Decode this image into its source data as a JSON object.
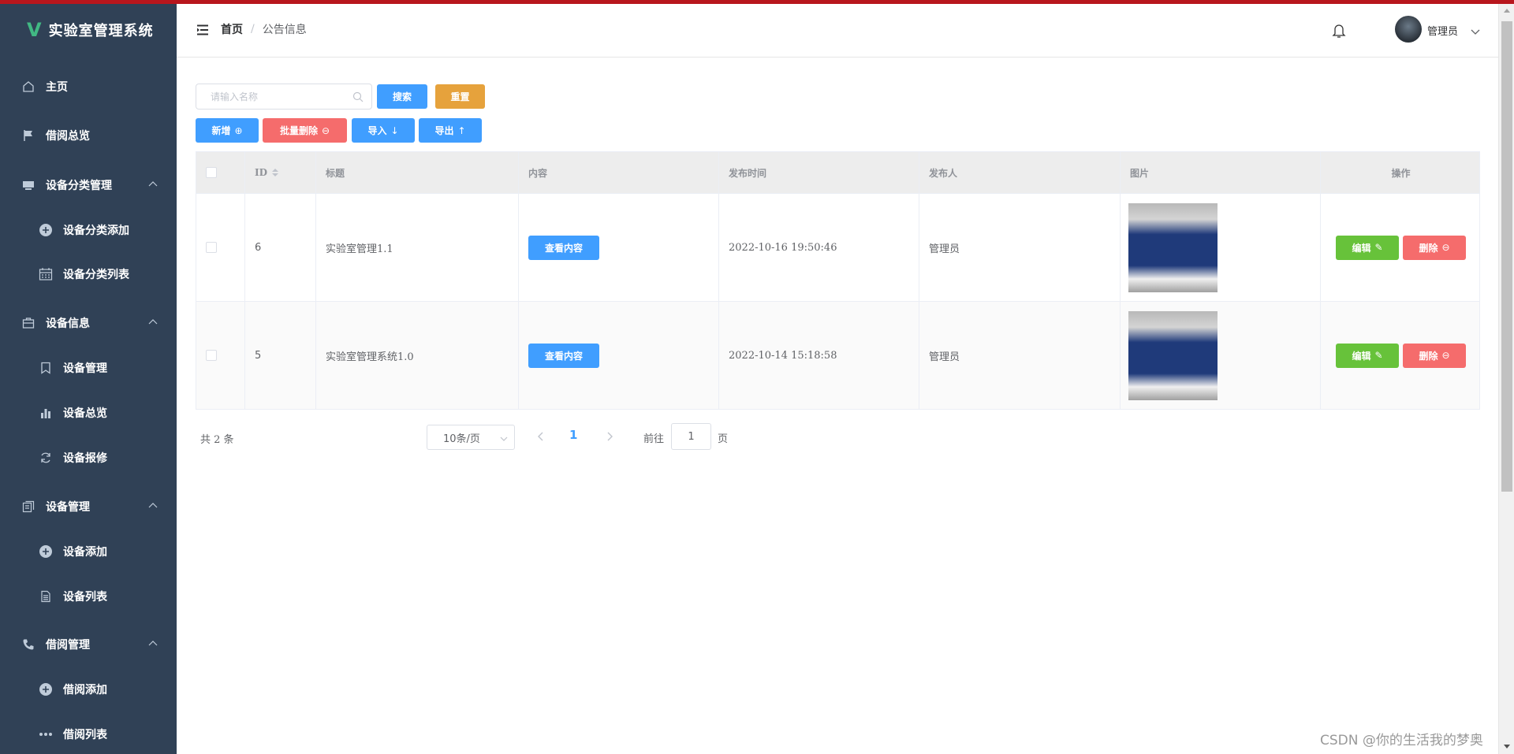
{
  "app": {
    "title": "实验室管理系统",
    "logo_letter": "V"
  },
  "sidebar": {
    "items": [
      {
        "label": "主页",
        "icon": "house-icon"
      },
      {
        "label": "借阅总览",
        "icon": "flag-icon"
      },
      {
        "label": "设备分类管理",
        "icon": "monitor-icon",
        "expanded": true
      },
      {
        "label": "设备分类添加",
        "icon": "circle-plus-icon",
        "sub": true
      },
      {
        "label": "设备分类列表",
        "icon": "calendar-icon",
        "sub": true
      },
      {
        "label": "设备信息",
        "icon": "suitcase-icon",
        "expanded": true
      },
      {
        "label": "设备管理",
        "icon": "bookmark-icon",
        "sub": true
      },
      {
        "label": "设备总览",
        "icon": "bar-chart-icon",
        "sub": true
      },
      {
        "label": "设备报修",
        "icon": "refresh-icon",
        "sub": true
      },
      {
        "label": "设备管理",
        "icon": "documents-icon",
        "expanded": true
      },
      {
        "label": "设备添加",
        "icon": "circle-plus-icon",
        "sub": true
      },
      {
        "label": "设备列表",
        "icon": "document-icon",
        "sub": true
      },
      {
        "label": "借阅管理",
        "icon": "phone-icon",
        "expanded": true
      },
      {
        "label": "借阅添加",
        "icon": "circle-plus-icon",
        "sub": true
      },
      {
        "label": "借阅列表",
        "icon": "more-icon",
        "sub": true
      }
    ]
  },
  "header": {
    "breadcrumb_home": "首页",
    "breadcrumb_sep": "/",
    "breadcrumb_current": "公告信息",
    "username": "管理员"
  },
  "toolbar": {
    "search_placeholder": "请输入名称",
    "search_label": "搜索",
    "reset_label": "重置",
    "add_label": "新增",
    "batch_delete_label": "批量删除",
    "import_label": "导入",
    "export_label": "导出"
  },
  "table": {
    "columns": [
      "ID",
      "标题",
      "内容",
      "发布时间",
      "发布人",
      "图片",
      "操作"
    ],
    "rows": [
      {
        "id": "6",
        "title": "实验室管理1.1",
        "content_button": "查看内容",
        "time": "2022-10-16 19:50:46",
        "publisher": "管理员",
        "edit_label": "编辑",
        "delete_label": "删除"
      },
      {
        "id": "5",
        "title": "实验室管理系统1.0",
        "content_button": "查看内容",
        "time": "2022-10-14 15:18:58",
        "publisher": "管理员",
        "edit_label": "编辑",
        "delete_label": "删除"
      }
    ]
  },
  "pagination": {
    "total_text": "共 2 条",
    "page_size": "10条/页",
    "current_page": "1",
    "goto_label": "前往",
    "goto_value": "1",
    "goto_suffix": "页"
  },
  "watermark": "CSDN @你的生活我的梦奥",
  "colors": {
    "sidebar": "#304156",
    "primary": "#409eff",
    "warning": "#e6a23c",
    "danger": "#f56c6c",
    "success": "#67c23a",
    "topstrip": "#b8161d"
  }
}
